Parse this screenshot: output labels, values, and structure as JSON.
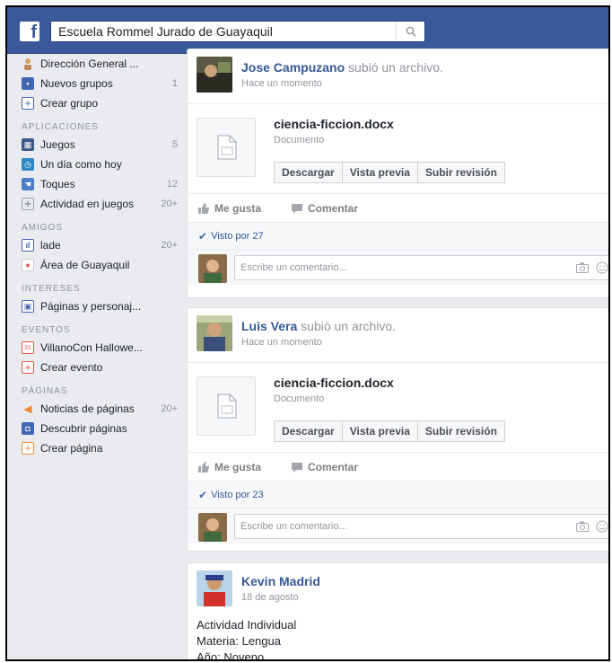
{
  "topbar": {
    "search_value": "Escuela Rommel Jurado de Guayaquil",
    "logo": "f"
  },
  "sidebar": {
    "items_top": [
      {
        "label": "Dirección General ...",
        "count": "",
        "icon": "person-icon",
        "color": "#d9a066"
      },
      {
        "label": "Nuevos grupos",
        "count": "1",
        "icon": "groups-icon",
        "color": "#4267b2"
      },
      {
        "label": "Crear grupo",
        "count": "",
        "icon": "plus-icon",
        "color": "#4267b2"
      }
    ],
    "apps_header": "APLICACIONES",
    "apps": [
      {
        "label": "Juegos",
        "count": "5",
        "icon": "games-icon",
        "color": "#6a7da3"
      },
      {
        "label": "Un día como hoy",
        "count": "",
        "icon": "clock-icon",
        "color": "#2d88c6"
      },
      {
        "label": "Toques",
        "count": "12",
        "icon": "poke-icon",
        "color": "#4f7fc8"
      },
      {
        "label": "Actividad en juegos",
        "count": "20+",
        "icon": "gamepad-icon",
        "color": "#9ea4af"
      }
    ],
    "friends_header": "AMIGOS",
    "friends": [
      {
        "label": "lade",
        "count": "20+",
        "icon": "friends-icon",
        "color": "#4267b2"
      },
      {
        "label": "Área de Guayaquil",
        "count": "",
        "icon": "pin-icon",
        "color": "#e0584a"
      }
    ],
    "interests_header": "INTERESES",
    "interests": [
      {
        "label": "Páginas y personaj...",
        "count": "",
        "icon": "pages-icon",
        "color": "#4267b2"
      }
    ],
    "events_header": "EVENTOS",
    "events": [
      {
        "label": "VillanoCon Hallowe...",
        "count": "",
        "icon": "calendar-icon",
        "color": "#e0584a"
      },
      {
        "label": "Crear evento",
        "count": "",
        "icon": "plus-icon",
        "color": "#e0584a"
      }
    ],
    "pages_header": "PÁGINAS",
    "pages": [
      {
        "label": "Noticias de páginas",
        "count": "20+",
        "icon": "megaphone-icon",
        "color": "#f28b37"
      },
      {
        "label": "Descubrir páginas",
        "count": "",
        "icon": "discover-icon",
        "color": "#4267b2"
      },
      {
        "label": "Crear página",
        "count": "",
        "icon": "plus-icon",
        "color": "#f28b37"
      }
    ]
  },
  "posts": [
    {
      "author": "Jose Campuzano",
      "action": "subió un archivo.",
      "time": "Hace un momento",
      "file_name": "ciencia-ficcion.docx",
      "file_type": "Documento",
      "buttons": {
        "download": "Descargar",
        "preview": "Vista previa",
        "revision": "Subir revisión"
      },
      "like": "Me gusta",
      "comment": "Comentar",
      "seen": "Visto por 27",
      "comment_placeholder": "Escribe un comentario..."
    },
    {
      "author": "Luis Vera",
      "action": "subió un archivo.",
      "time": "Hace un momento",
      "file_name": "ciencia-ficcion.docx",
      "file_type": "Documento",
      "buttons": {
        "download": "Descargar",
        "preview": "Vista previa",
        "revision": "Subir revisión"
      },
      "like": "Me gusta",
      "comment": "Comentar",
      "seen": "Visto por 23",
      "comment_placeholder": "Escribe un comentario..."
    },
    {
      "author": "Kevin Madrid",
      "time": "18 de agosto",
      "lines": [
        "Actividad Individual",
        "Materia: Lengua",
        "Año: Noveno"
      ]
    }
  ]
}
